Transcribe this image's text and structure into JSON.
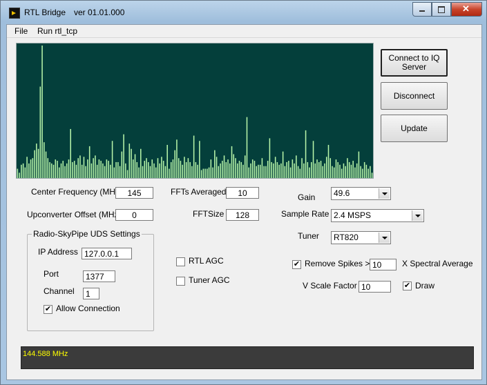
{
  "window": {
    "title": "RTL Bridge",
    "version": "ver 01.01.000"
  },
  "menu": [
    "File",
    "Run rtl_tcp"
  ],
  "buttons": {
    "connect": "Connect to IQ Server",
    "disconnect": "Disconnect",
    "update": "Update"
  },
  "spectrum": {
    "bar_color": "#b8f5a9",
    "background": "#043f3b",
    "bins": [
      0.07,
      0.04,
      0.1,
      0.11,
      0.08,
      0.16,
      0.11,
      0.14,
      0.15,
      0.21,
      0.26,
      0.22,
      0.69,
      1.0,
      0.27,
      0.2,
      0.15,
      0.12,
      0.11,
      0.1,
      0.14,
      0.13,
      0.08,
      0.11,
      0.13,
      0.09,
      0.11,
      0.14,
      0.37,
      0.12,
      0.13,
      0.1,
      0.15,
      0.17,
      0.1,
      0.16,
      0.09,
      0.14,
      0.24,
      0.11,
      0.15,
      0.17,
      0.1,
      0.14,
      0.13,
      0.11,
      0.09,
      0.14,
      0.13,
      0.1,
      0.28,
      0.08,
      0.12,
      0.12,
      0.09,
      0.2,
      0.33,
      0.11,
      0.06,
      0.26,
      0.22,
      0.14,
      0.18,
      0.12,
      0.08,
      0.22,
      0.09,
      0.13,
      0.15,
      0.12,
      0.09,
      0.14,
      0.11,
      0.08,
      0.15,
      0.11,
      0.16,
      0.13,
      0.09,
      0.25,
      0.07,
      0.12,
      0.14,
      0.21,
      0.29,
      0.15,
      0.13,
      0.1,
      0.16,
      0.12,
      0.15,
      0.12,
      0.09,
      0.32,
      0.12,
      0.1,
      0.28,
      0.06,
      0.07,
      0.07,
      0.07,
      0.08,
      0.14,
      0.08,
      0.21,
      0.16,
      0.09,
      0.11,
      0.13,
      0.17,
      0.12,
      0.14,
      0.11,
      0.24,
      0.18,
      0.15,
      0.11,
      0.13,
      0.12,
      0.1,
      0.17,
      0.46,
      0.08,
      0.11,
      0.14,
      0.13,
      0.09,
      0.1,
      0.1,
      0.15,
      0.09,
      0.09,
      0.13,
      0.3,
      0.12,
      0.11,
      0.16,
      0.12,
      0.1,
      0.11,
      0.2,
      0.09,
      0.12,
      0.13,
      0.08,
      0.14,
      0.11,
      0.17,
      0.09,
      0.07,
      0.15,
      0.11,
      0.36,
      0.12,
      0.08,
      0.12,
      0.28,
      0.11,
      0.14,
      0.12,
      0.13,
      0.09,
      0.11,
      0.16,
      0.25,
      0.15,
      0.09,
      0.08,
      0.14,
      0.12,
      0.1,
      0.07,
      0.11,
      0.09,
      0.15,
      0.12,
      0.1,
      0.13,
      0.08,
      0.11,
      0.2,
      0.09,
      0.07,
      0.12,
      0.1,
      0.07,
      0.09,
      0.04
    ]
  },
  "fields": {
    "center_freq_label": "Center Frequency (MHz)",
    "center_freq_value": "145",
    "upconverter_label": "Upconverter Offset (MHz)",
    "upconverter_value": "0",
    "ffts_avg_label": "FFTs Averaged",
    "ffts_avg_value": "10",
    "fftsize_label": "FFTSize",
    "fftsize_value": "128",
    "gain_label": "Gain",
    "gain_value": "49.6",
    "sample_rate_label": "Sample Rate",
    "sample_rate_value": "2.4 MSPS",
    "tuner_label": "Tuner",
    "tuner_value": "RT820"
  },
  "uds_group": {
    "title": "Radio-SkyPipe UDS Settings",
    "ip_label": "IP Address",
    "ip_value": "127.0.0.1",
    "port_label": "Port",
    "port_value": "1377",
    "channel_label": "Channel",
    "channel_value": "1",
    "allow_label": "Allow Connection",
    "allow_checked": "✔"
  },
  "options": {
    "rtl_agc_label": "RTL AGC",
    "tuner_agc_label": "Tuner AGC",
    "remove_spikes_label": "Remove Spikes >",
    "remove_spikes_checked": "✔",
    "spikes_value": "10",
    "spectral_avg_label": "X Spectral Average",
    "vscale_label": "V Scale Factor",
    "vscale_value": "10",
    "draw_label": "Draw",
    "draw_checked": "✔"
  },
  "status": {
    "frequency": "144.588 MHz"
  }
}
